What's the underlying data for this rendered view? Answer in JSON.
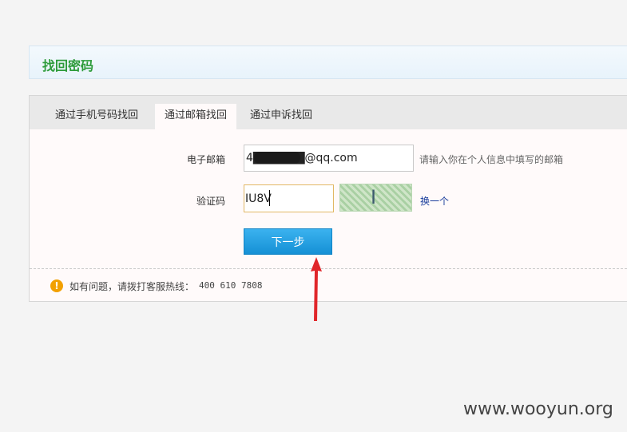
{
  "header": {
    "title": "找回密码"
  },
  "tabs": [
    {
      "label": "通过手机号码找回",
      "active": false
    },
    {
      "label": "通过邮箱找回",
      "active": true
    },
    {
      "label": "通过申诉找回",
      "active": false
    }
  ],
  "form": {
    "email_label": "电子邮箱",
    "email_value": "4██████@qq.com",
    "email_hint": "请输入你在个人信息中填写的邮箱",
    "code_label": "验证码",
    "code_value": "IU8V",
    "captcha_text": "I U8V",
    "change_link": "换一个",
    "next_button": "下一步"
  },
  "help": {
    "icon": "warning-icon",
    "text": "如有问题，请拨打客服热线：",
    "phone": "400 610 7808"
  },
  "annotation": {
    "icon": "red-arrow-icon",
    "color": "#e0262a"
  },
  "watermark": "www.wooyun.org",
  "colors": {
    "accent": "#2d9b3a",
    "button": "#1590d5",
    "link": "#1a3d9c"
  }
}
